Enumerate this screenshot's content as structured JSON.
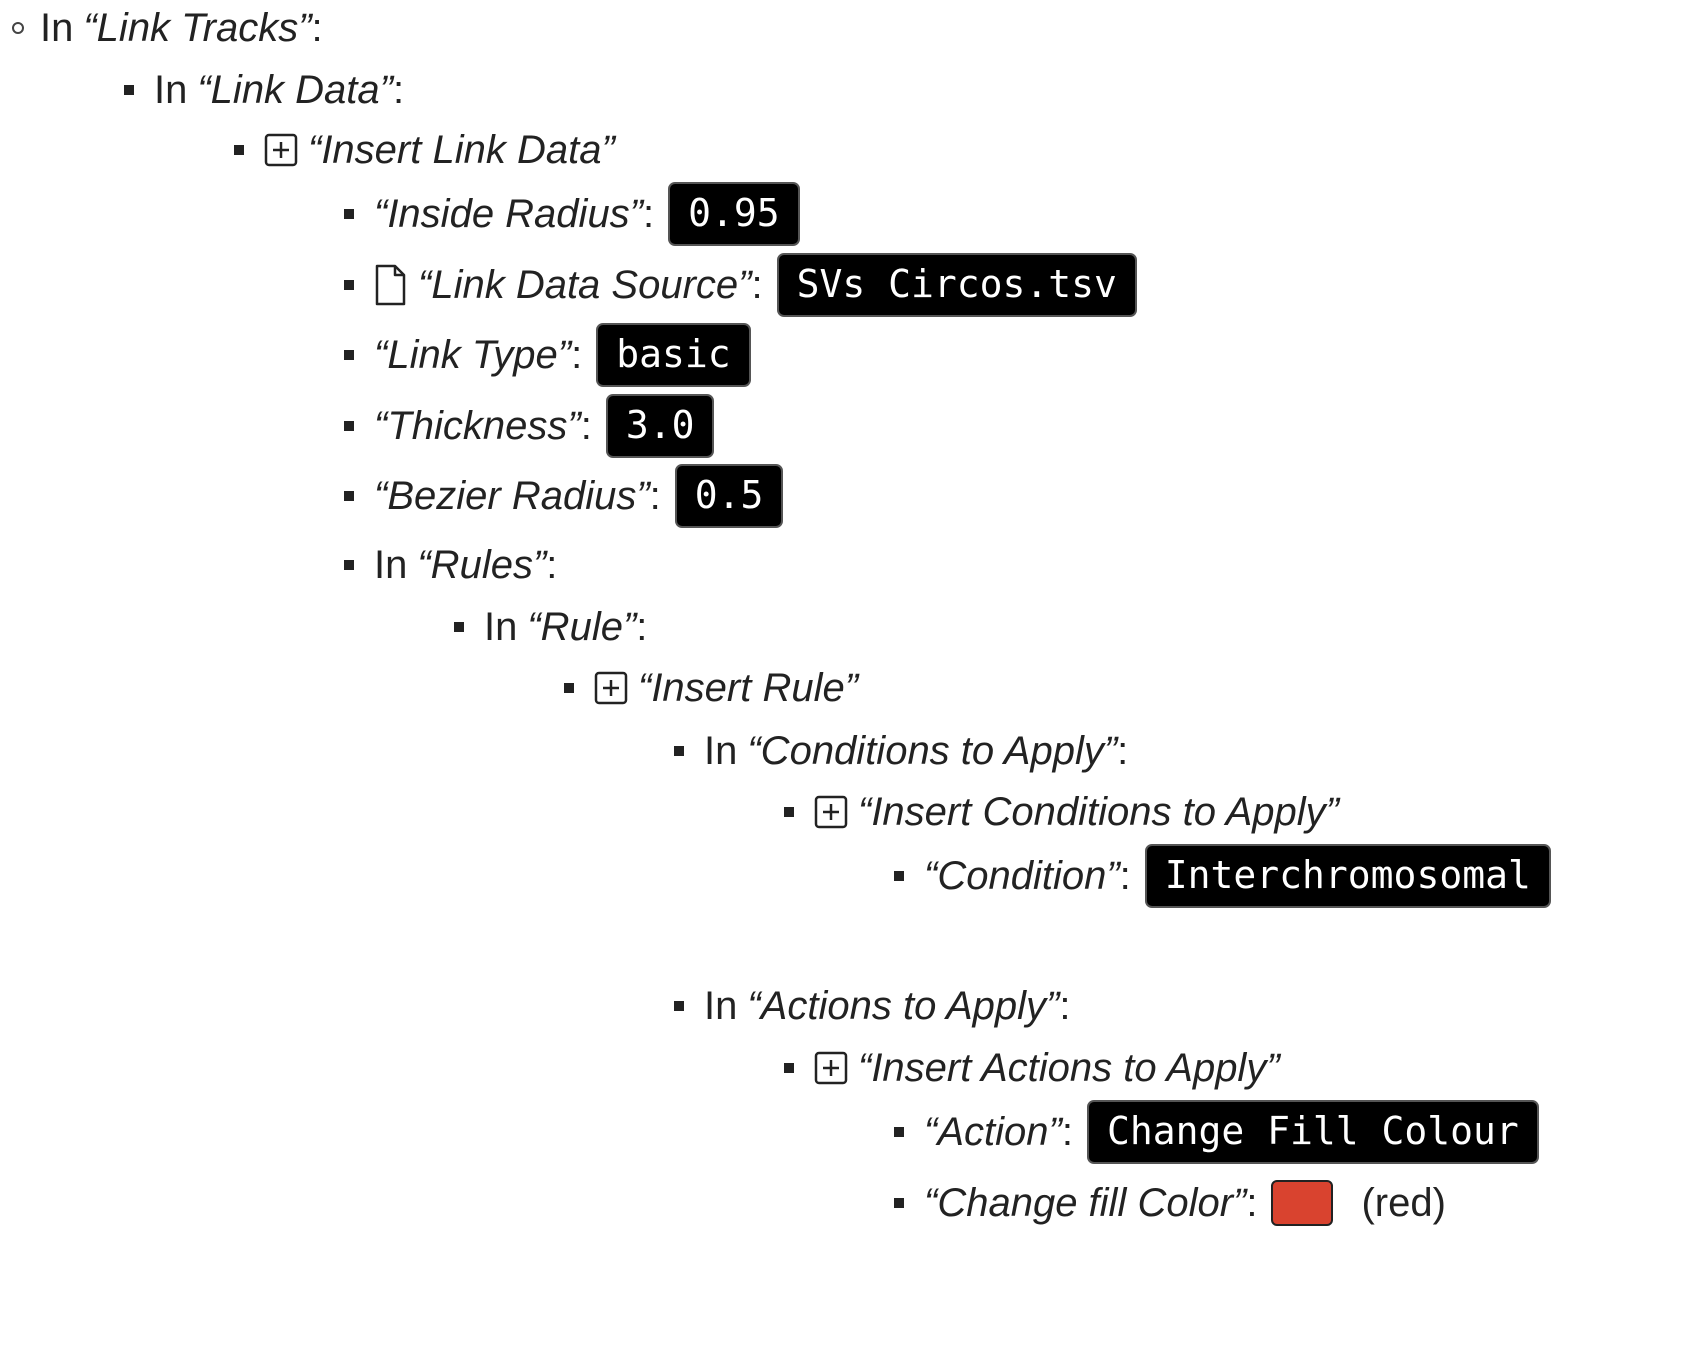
{
  "tree": {
    "link_tracks": {
      "prefix": "In",
      "name": "“Link Tracks”",
      "suffix": ":"
    },
    "link_data": {
      "prefix": "In",
      "name": "“Link Data”",
      "suffix": ":"
    },
    "insert_link_data": {
      "name": "“Insert Link Data”",
      "icon": "plus-square-icon"
    },
    "inside_radius": {
      "name": "“Inside Radius”",
      "suffix": ":",
      "value": "0.95"
    },
    "link_data_source": {
      "name": "“Link Data Source”",
      "suffix": ":",
      "value": "SVs Circos.tsv",
      "icon": "file-icon"
    },
    "link_type": {
      "name": "“Link Type”",
      "suffix": ":",
      "value": "basic"
    },
    "thickness": {
      "name": "“Thickness”",
      "suffix": ":",
      "value": "3.0"
    },
    "bezier_radius": {
      "name": "“Bezier Radius”",
      "suffix": ":",
      "value": "0.5"
    },
    "rules": {
      "prefix": "In",
      "name": "“Rules”",
      "suffix": ":"
    },
    "rule": {
      "prefix": "In",
      "name": "“Rule”",
      "suffix": ":"
    },
    "insert_rule": {
      "name": "“Insert Rule”",
      "icon": "plus-square-icon"
    },
    "conditions_to_apply": {
      "prefix": "In",
      "name": "“Conditions to Apply”",
      "suffix": ":"
    },
    "insert_conditions": {
      "name": "“Insert Conditions to Apply”",
      "icon": "plus-square-icon"
    },
    "condition": {
      "name": "“Condition”",
      "suffix": ":",
      "value": "Interchromosomal"
    },
    "actions_to_apply": {
      "prefix": "In",
      "name": "“Actions to Apply”",
      "suffix": ":"
    },
    "insert_actions": {
      "name": "“Insert Actions to Apply”",
      "icon": "plus-square-icon"
    },
    "action": {
      "name": "“Action”",
      "suffix": ":",
      "value": "Change Fill Colour"
    },
    "change_fill_color": {
      "name": "“Change fill Color”",
      "suffix": ":",
      "swatch_color": "#d9432f",
      "color_label": "(red)"
    }
  }
}
